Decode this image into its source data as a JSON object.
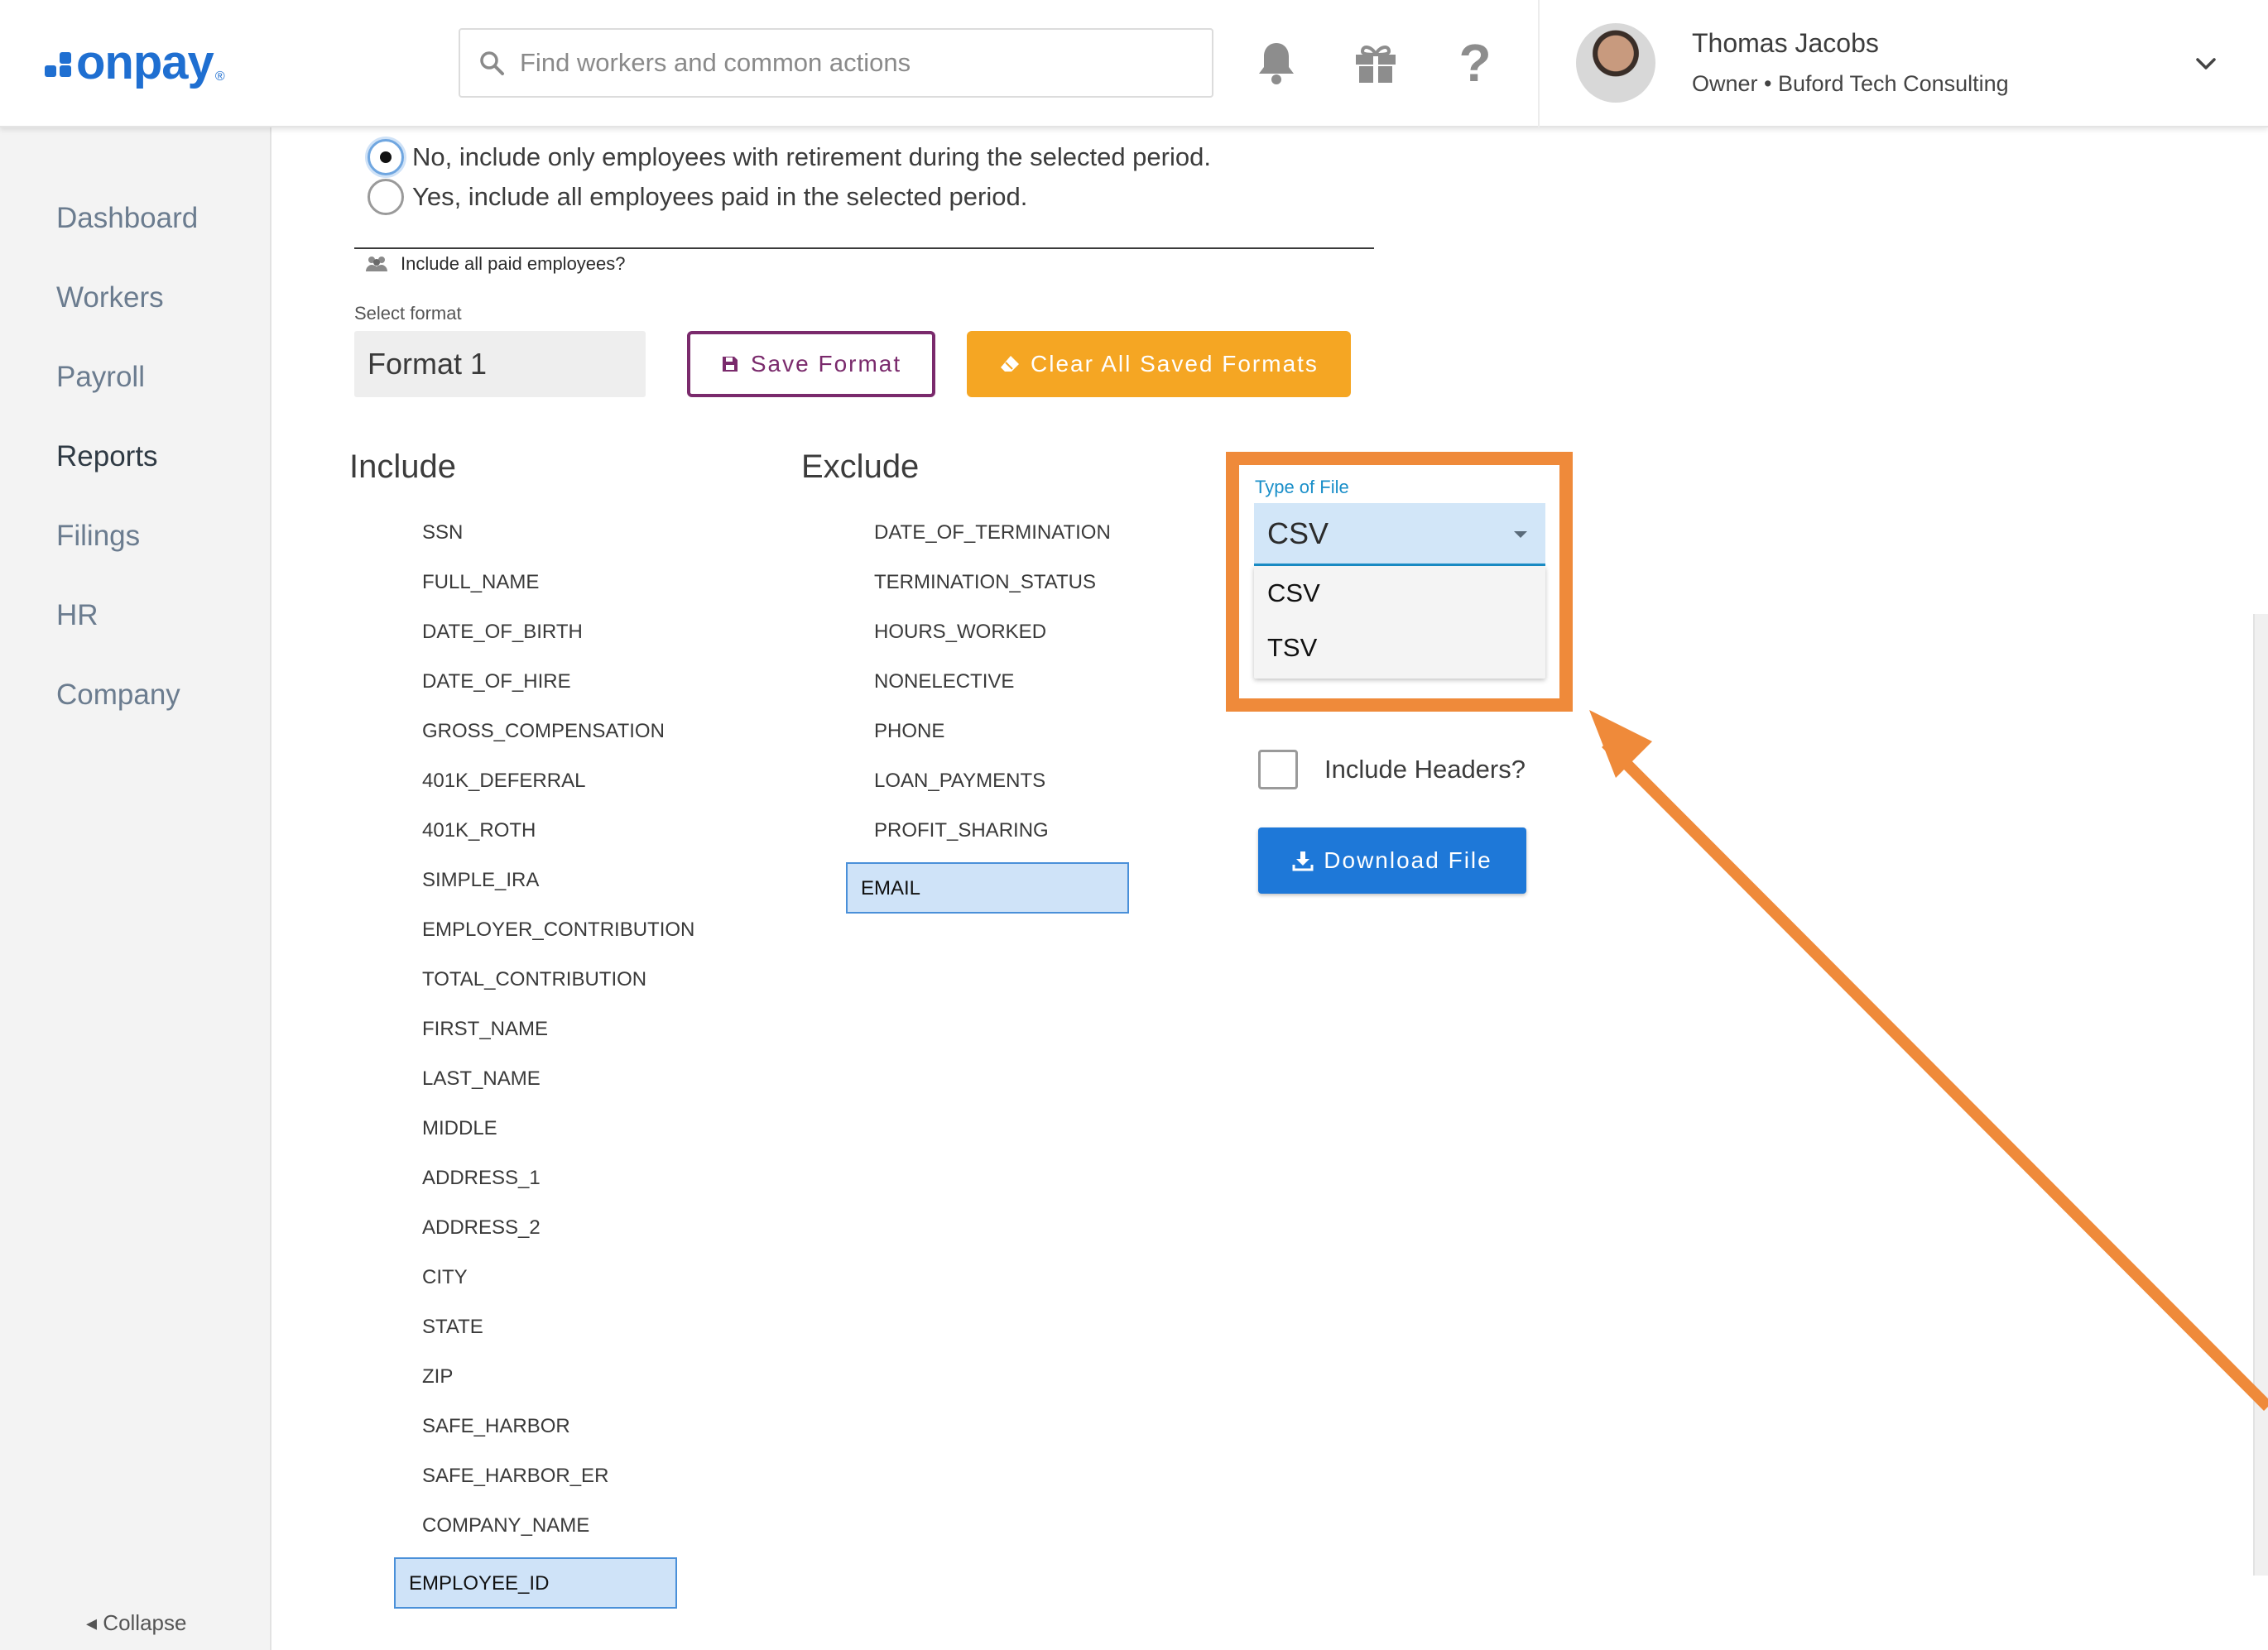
{
  "header": {
    "logo_text": "onpay",
    "logo_mark": "®",
    "search_placeholder": "Find workers and common actions",
    "icons": [
      "bell-icon",
      "gift-icon",
      "help-icon"
    ],
    "help_glyph": "?",
    "user": {
      "name": "Thomas Jacobs",
      "subtitle": "Owner • Buford Tech Consulting"
    }
  },
  "sidebar": {
    "items": [
      {
        "label": "Dashboard",
        "active": false
      },
      {
        "label": "Workers",
        "active": false
      },
      {
        "label": "Payroll",
        "active": false
      },
      {
        "label": "Reports",
        "active": true
      },
      {
        "label": "Filings",
        "active": false
      },
      {
        "label": "HR",
        "active": false
      },
      {
        "label": "Company",
        "active": false
      }
    ],
    "collapse_label": "Collapse",
    "collapse_glyph": "◂"
  },
  "main": {
    "radio_options": [
      {
        "label": "No, include only employees with retirement during the selected period.",
        "checked": true
      },
      {
        "label": "Yes, include all employees paid in the selected period.",
        "checked": false
      }
    ],
    "radio_caption": "Include all paid employees?",
    "select_format_label": "Select format",
    "format_value": "Format 1",
    "save_format_label": "Save Format",
    "clear_formats_label": "Clear All Saved Formats",
    "include_heading": "Include",
    "exclude_heading": "Exclude",
    "include_fields": [
      "SSN",
      "FULL_NAME",
      "DATE_OF_BIRTH",
      "DATE_OF_HIRE",
      "GROSS_COMPENSATION",
      "401K_DEFERRAL",
      "401K_ROTH",
      "SIMPLE_IRA",
      "EMPLOYER_CONTRIBUTION",
      "TOTAL_CONTRIBUTION",
      "FIRST_NAME",
      "LAST_NAME",
      "MIDDLE",
      "ADDRESS_1",
      "ADDRESS_2",
      "CITY",
      "STATE",
      "ZIP",
      "SAFE_HARBOR",
      "SAFE_HARBOR_ER",
      "COMPANY_NAME",
      "EMPLOYEE_ID"
    ],
    "include_selected": "EMPLOYEE_ID",
    "exclude_fields": [
      "DATE_OF_TERMINATION",
      "TERMINATION_STATUS",
      "HOURS_WORKED",
      "NONELECTIVE",
      "PHONE",
      "LOAN_PAYMENTS",
      "PROFIT_SHARING",
      "EMAIL"
    ],
    "exclude_selected": "EMAIL",
    "file_type": {
      "label": "Type of File",
      "value": "CSV",
      "options": [
        "CSV",
        "TSV"
      ]
    },
    "include_headers_label": "Include Headers?",
    "include_headers_checked": false,
    "download_label": "Download File"
  },
  "colors": {
    "brand": "#1f6fd1",
    "save_border": "#7a2a6c",
    "clear_bg": "#f5a623",
    "download_bg": "#1e78d8",
    "annotation": "#ef8a3a",
    "selected_bg": "#cfe3f8"
  }
}
